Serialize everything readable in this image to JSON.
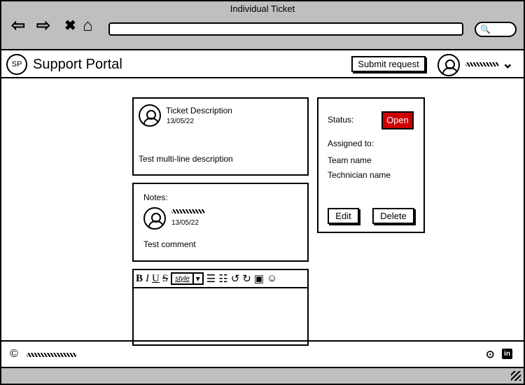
{
  "window": {
    "title": "Individual Ticket"
  },
  "browser": {
    "back": "⇦",
    "forward": "⇨",
    "stop": "✖",
    "home": "⌂",
    "search_icon": "🔍"
  },
  "header": {
    "logo": "SP",
    "brand": "Support Portal",
    "submit_label": "Submit request",
    "user_chevron": "⌄"
  },
  "ticket": {
    "title": "Ticket Description",
    "date": "13/05/22",
    "description": "Test multi-line description"
  },
  "notes": {
    "label": "Notes:",
    "date": "13/05/22",
    "comment": "Test comment"
  },
  "status": {
    "status_label": "Status:",
    "status_value": "Open",
    "status_color": "#cc0000",
    "assigned_label": "Assigned to:",
    "team": "Team name",
    "technician": "Technician name",
    "edit_label": "Edit",
    "delete_label": "Delete"
  },
  "editor": {
    "bold": "B",
    "italic": "I",
    "underline": "U",
    "strike": "S",
    "style": "style",
    "dropdown": "▾",
    "bullets": "☰",
    "numbered": "☷",
    "undo": "↺",
    "redo": "↻",
    "image": "▣",
    "emoji": "☺"
  },
  "footer": {
    "copyright": "©",
    "github": "⊙",
    "linkedin": "in"
  }
}
